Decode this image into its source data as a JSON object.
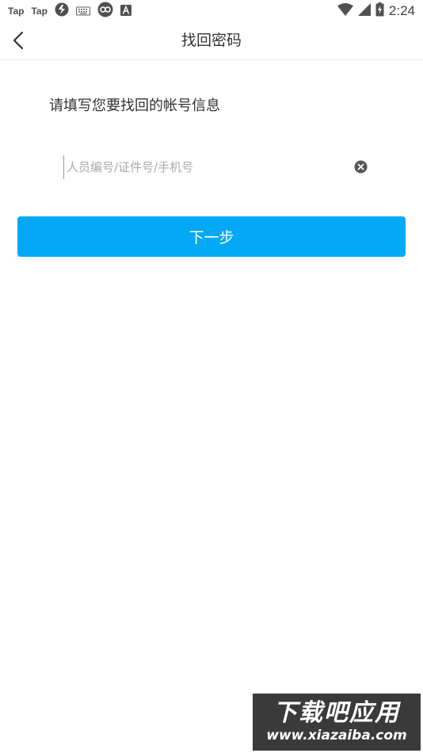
{
  "status_bar": {
    "left_icons": [
      "tap-icon",
      "tap-icon",
      "app-icon",
      "keyboard-icon",
      "app-icon",
      "app-icon"
    ],
    "tap_label_1": "Tap",
    "tap_label_2": "Tap",
    "time": "2:24",
    "right_icons": [
      "wifi-icon",
      "cellular-signal-icon",
      "battery-charging-icon"
    ]
  },
  "app_bar": {
    "back_icon": "chevron-left-icon",
    "title": "找回密码"
  },
  "form": {
    "prompt": "请填写您要找回的帐号信息",
    "account_value": "",
    "account_placeholder": "人员编号/证件号/手机号",
    "clear_icon": "clear-circle-icon",
    "next_label": "下一步"
  },
  "watermark": {
    "title": "下载吧应用",
    "url": "www.xiazaiba.com"
  },
  "colors": {
    "primary_button": "#03a9f4",
    "title_text": "#333333",
    "placeholder_text": "#aaaaaa",
    "divider": "#e6e6e6"
  }
}
